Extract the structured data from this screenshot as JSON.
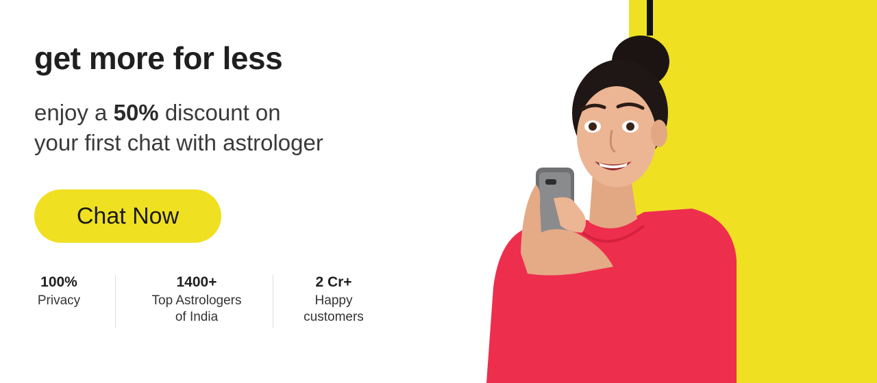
{
  "banner": {
    "headline": "get more for less",
    "subline": {
      "line1_prefix": "enjoy a ",
      "line1_highlight": "50%",
      "line1_suffix": " discount on",
      "line2": "your first chat with astrologer"
    },
    "cta_label": "Chat Now",
    "stats": [
      {
        "value": "100%",
        "label_line1": "Privacy",
        "label_line2": ""
      },
      {
        "value": "1400+",
        "label_line1": "Top Astrologers",
        "label_line2": "of India"
      },
      {
        "value": "2 Cr+",
        "label_line1": "Happy",
        "label_line2": "customers"
      }
    ]
  },
  "colors": {
    "accent_yellow": "#EFE022",
    "headline_text": "#1f1f1f",
    "body_text": "#3a3a3a",
    "stripe": "#111111",
    "shirt": "#EE2E4D"
  },
  "icons": {
    "illustration": "woman-with-phone-illustration"
  }
}
